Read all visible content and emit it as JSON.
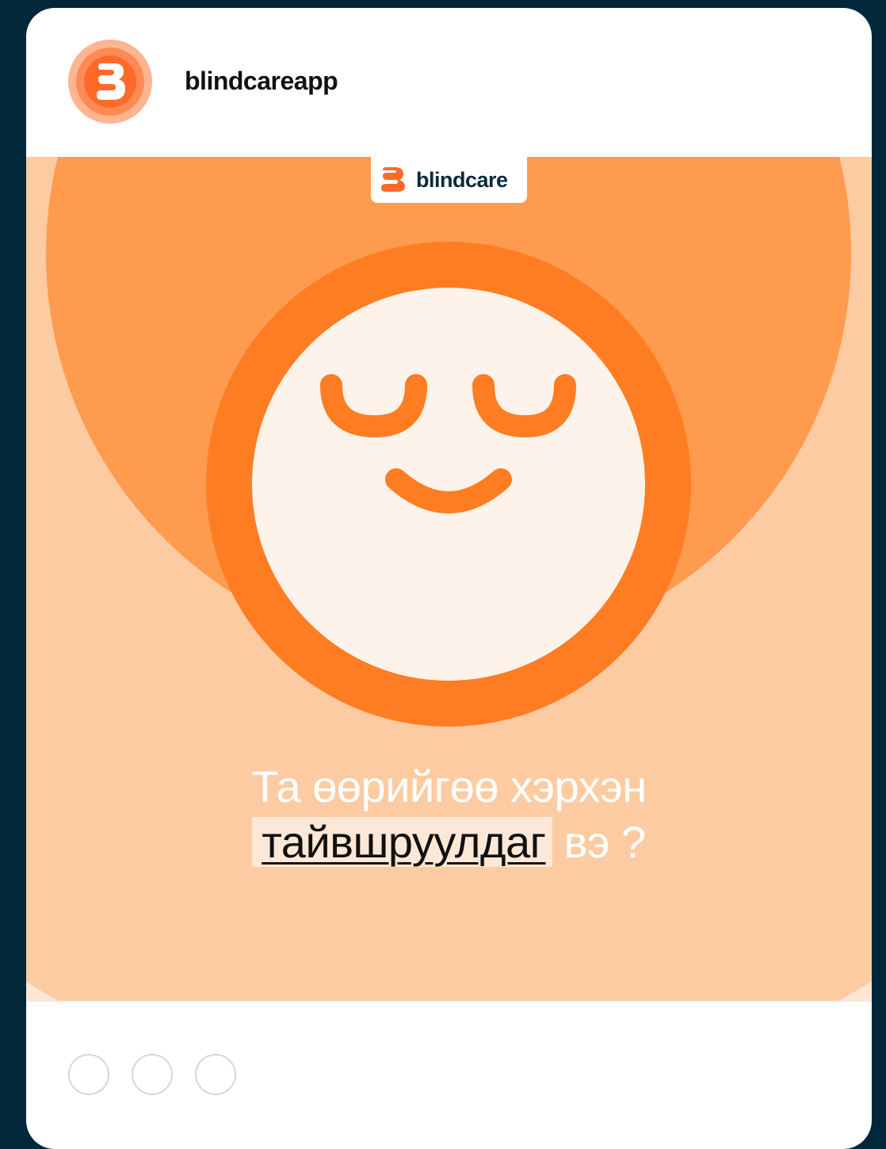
{
  "post": {
    "username": "blindcareapp",
    "avatar_icon": "blindcare-logo-icon",
    "brand": {
      "label": "blindcare",
      "icon": "blindcare-logo-icon",
      "color": "#ff6a2a"
    },
    "headline": {
      "line1": "Та өөрийгөө хэрхэн",
      "highlight": "тайвшруулдаг",
      "line2_rest": " вэ ?"
    },
    "colors": {
      "background": "#03273a",
      "ring_outer": "#fccba2",
      "ring_mid": "#ff9b4e",
      "ring_inner": "#ff7d22",
      "face": "#fef3ea"
    }
  },
  "carousel": {
    "dots": [
      "slide-1",
      "slide-2",
      "slide-3"
    ]
  }
}
